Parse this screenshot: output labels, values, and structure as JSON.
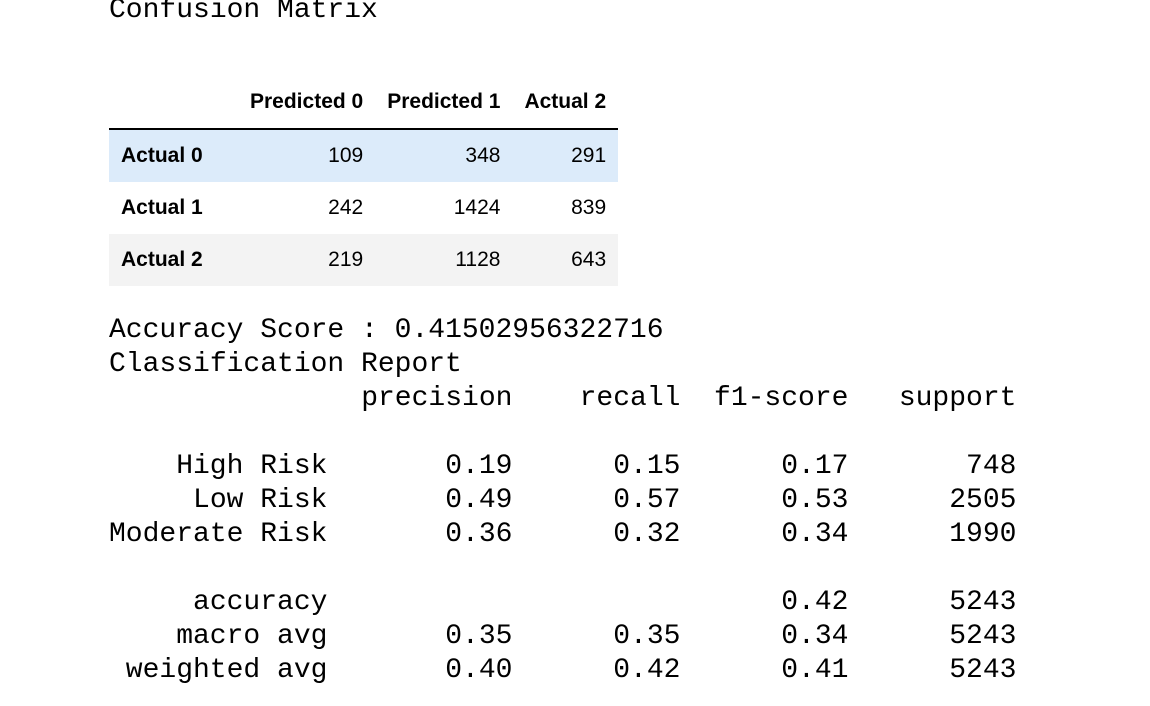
{
  "confusion_matrix": {
    "title": "Confusion Matrix",
    "columns": [
      "Predicted 0",
      "Predicted 1",
      "Actual 2"
    ],
    "rows": [
      {
        "label": "Actual 0",
        "values": [
          "109",
          "348",
          "291"
        ]
      },
      {
        "label": "Actual 1",
        "values": [
          "242",
          "1424",
          "839"
        ]
      },
      {
        "label": "Actual 2",
        "values": [
          "219",
          "1128",
          "643"
        ]
      }
    ],
    "row_colors": [
      "#dcebfa",
      "#ffffff",
      "#f3f3f3"
    ]
  },
  "accuracy": {
    "label": "Accuracy Score : ",
    "value": "0.41502956322716"
  },
  "report": {
    "title": "Classification Report",
    "headers": [
      "precision",
      "recall",
      "f1-score",
      "support"
    ],
    "class_rows": [
      {
        "label": "High Risk",
        "precision": "0.19",
        "recall": "0.15",
        "f1": "0.17",
        "support": "748"
      },
      {
        "label": "Low Risk",
        "precision": "0.49",
        "recall": "0.57",
        "f1": "0.53",
        "support": "2505"
      },
      {
        "label": "Moderate Risk",
        "precision": "0.36",
        "recall": "0.32",
        "f1": "0.34",
        "support": "1990"
      }
    ],
    "summary_rows": [
      {
        "label": "accuracy",
        "precision": "",
        "recall": "",
        "f1": "0.42",
        "support": "5243"
      },
      {
        "label": "macro avg",
        "precision": "0.35",
        "recall": "0.35",
        "f1": "0.34",
        "support": "5243"
      },
      {
        "label": "weighted avg",
        "precision": "0.40",
        "recall": "0.42",
        "f1": "0.41",
        "support": "5243"
      }
    ]
  }
}
